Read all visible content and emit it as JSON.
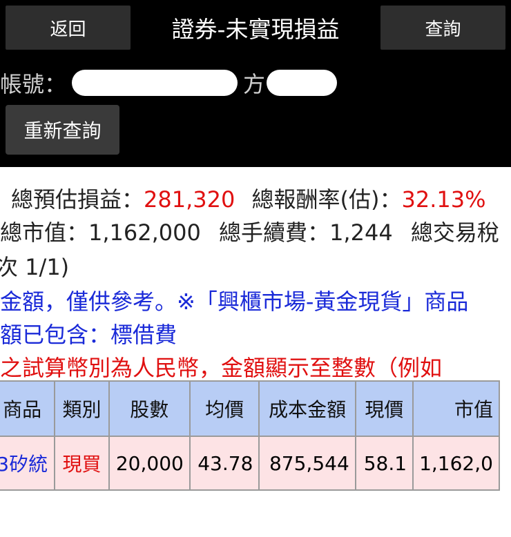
{
  "header": {
    "back_label": "返回",
    "title": "證券-未實現損益",
    "query_label": "查詢",
    "account_label": "帳號：",
    "account_partial_label": "方",
    "requery_label": "重新查詢"
  },
  "summary": {
    "total_est_pl_label": "總預估損益：",
    "total_est_pl_value": "281,320",
    "total_return_label": "總報酬率(估)：",
    "total_return_value": "32.13%",
    "total_market_value_label": "總市值：",
    "total_market_value": "1,162,000",
    "total_fee_label": "總手續費：",
    "total_fee_value": "1,244",
    "total_tax_label": "總交易稅",
    "page_info": "次 1/1)",
    "note1": "金額，僅供參考。※「興櫃市場-黃金現貨」商品",
    "note2": "額已包含：標借費",
    "note3": "之試算幣別為人民幣，金額顯示至整數（例如"
  },
  "table": {
    "headers": [
      "商品",
      "類別",
      "股數",
      "均價",
      "成本金額",
      "現價",
      "市值"
    ],
    "rows": [
      [
        "3矽統",
        "現買",
        "20,000",
        "43.78",
        "875,544",
        "58.1",
        "1,162,0"
      ]
    ]
  },
  "colors": {
    "header_bg": "#000000",
    "button_bg": "#2e2e2e",
    "highlight_red": "#e01010",
    "link_blue": "#1a2ad8",
    "table_header_bg": "#b8cdf5",
    "table_row_bg": "#fde3e5"
  }
}
